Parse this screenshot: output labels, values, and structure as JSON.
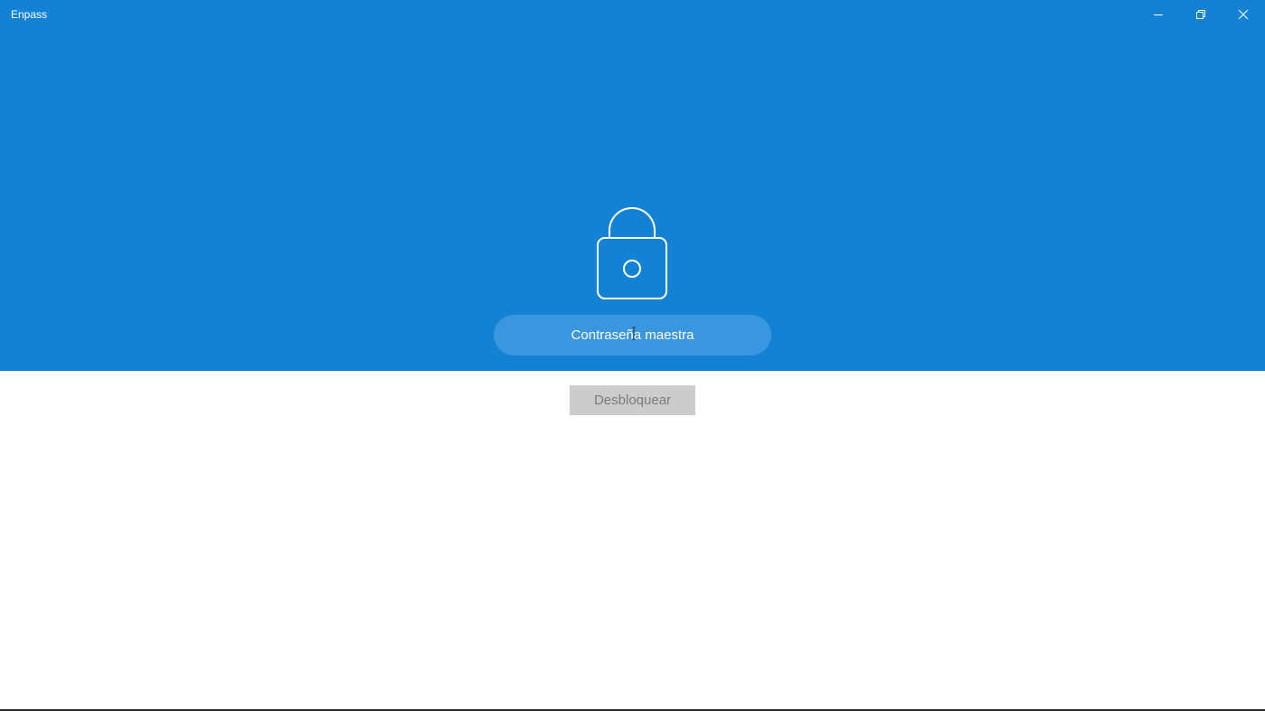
{
  "window": {
    "title": "Enpass",
    "controls": {
      "minimize_icon": "minimize-icon",
      "maximize_icon": "restore-icon",
      "close_icon": "close-icon"
    }
  },
  "lock_screen": {
    "icon": "padlock-icon",
    "password_placeholder": "Contraseña maestra",
    "password_value": "",
    "unlock_label": "Desbloquear",
    "unlock_enabled": false
  },
  "colors": {
    "accent": "#1382d4",
    "field_background": "#3a96de",
    "disabled_button": "#cccccc",
    "disabled_text": "#7a7a7a"
  }
}
